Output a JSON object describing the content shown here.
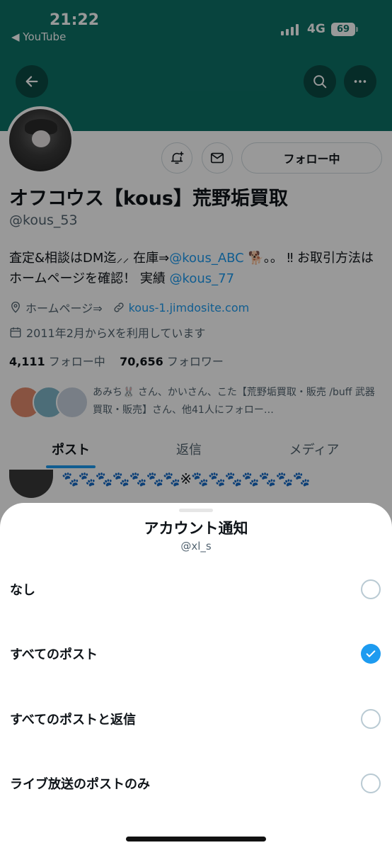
{
  "status_bar": {
    "time": "21:22",
    "back_app": "◀ YouTube",
    "network": "4G",
    "battery": "69"
  },
  "profile": {
    "follow_button": "フォロー中",
    "display_name": "オフコウス【kous】荒野垢買取",
    "handle": "@kous_53",
    "bio_part1": "査定&相談はDM迄⸝⸝ 在庫⇒",
    "bio_link1": "@kous_ABC",
    "bio_part2": " 🐕。。 ‼ お取引方法はホームページを確認！ 実績 ",
    "bio_link2": "@kous_77",
    "location": "ホームページ⇒",
    "website": "kous-1.jimdosite.com",
    "joined": "2011年2月からXを利用しています",
    "following_count": "4,111",
    "following_label": "フォロー中",
    "followers_count": "70,656",
    "followers_label": "フォロワー",
    "followed_by": "あみち🐰 さん、かいさん、こた【荒野垢買取・販売 /buff 武器買取・販売】さん、他41人にフォロー…"
  },
  "tabs": [
    {
      "label": "ポスト",
      "active": true
    },
    {
      "label": "返信",
      "active": false
    },
    {
      "label": "メディア",
      "active": false
    }
  ],
  "post_preview": {
    "text": "🐾🐾🐾🐾🐾🐾🐾※🐾🐾🐾🐾🐾🐾🐾"
  },
  "sheet": {
    "title": "アカウント通知",
    "subtitle": "@xl_s",
    "options": [
      {
        "label": "なし",
        "selected": false
      },
      {
        "label": "すべてのポスト",
        "selected": true
      },
      {
        "label": "すべてのポストと返信",
        "selected": false
      },
      {
        "label": "ライブ放送のポストのみ",
        "selected": false
      }
    ]
  },
  "colors": {
    "banner": "#0d7267",
    "accent": "#1d9bf0",
    "text_secondary": "#536471"
  }
}
